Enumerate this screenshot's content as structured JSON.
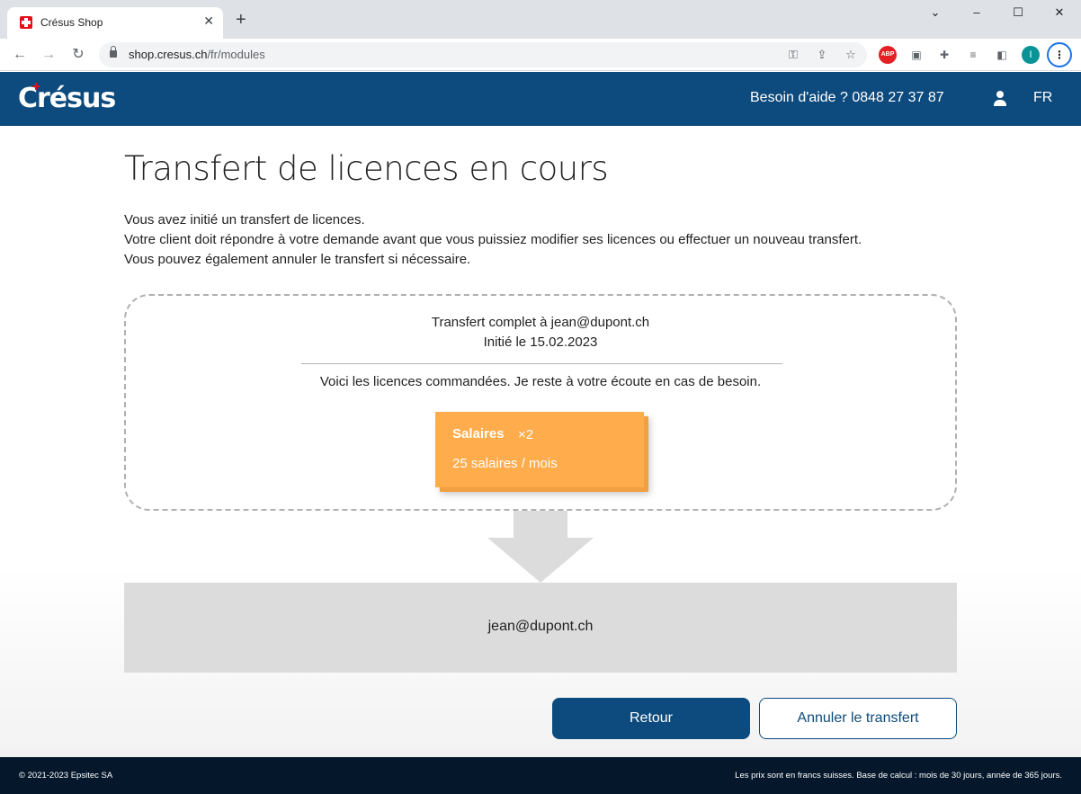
{
  "browser": {
    "tab_title": "Crésus Shop",
    "tab_close": "✕",
    "new_tab": "+",
    "url_host": "shop.cresus.ch",
    "url_path": "/fr/modules",
    "profile_initial": "I",
    "abp_label": "ABP",
    "window_controls": {
      "minimize": "–",
      "maximize": "☐",
      "close": "✕",
      "dropdown": "⌄"
    }
  },
  "header": {
    "logo_text": "Crésus",
    "help_text": "Besoin d'aide ?  0848 27 37 87",
    "language": "FR"
  },
  "main": {
    "title": "Transfert de licences en cours",
    "intro_lines": [
      "Vous avez initié un transfert de licences.",
      "Votre client doit répondre à votre demande avant que vous puissiez modifier ses licences ou effectuer un nouveau transfert.",
      "Vous pouvez également annuler le transfert si nécessaire."
    ],
    "transfer": {
      "heading": "Transfert complet à jean@dupont.ch",
      "initiated": "Initié le 15.02.2023",
      "message": "Voici les licences commandées. Je reste à votre écoute en cas de besoin."
    },
    "license": {
      "name": "Salaires",
      "quantity": "×2",
      "description": "25 salaires / mois"
    },
    "recipient": "jean@dupont.ch",
    "buttons": {
      "back": "Retour",
      "cancel": "Annuler le transfert"
    }
  },
  "footer": {
    "copyright": "© 2021-2023 Epsitec SA",
    "note": "Les prix sont en francs suisses. Base de calcul : mois de 30 jours, année de 365 jours."
  },
  "colors": {
    "brand_blue": "#0d4a7d",
    "license_orange": "#ffac4c",
    "footer_bg": "#05182b"
  }
}
